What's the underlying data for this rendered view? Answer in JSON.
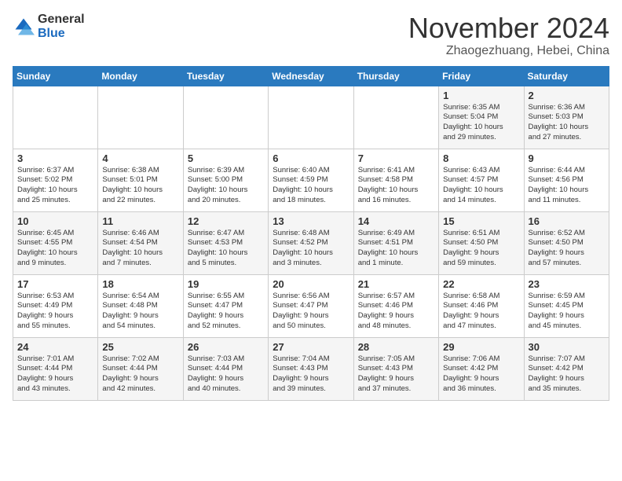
{
  "logo": {
    "general": "General",
    "blue": "Blue"
  },
  "title": "November 2024",
  "location": "Zhaogezhuang, Hebei, China",
  "days_of_week": [
    "Sunday",
    "Monday",
    "Tuesday",
    "Wednesday",
    "Thursday",
    "Friday",
    "Saturday"
  ],
  "weeks": [
    [
      {
        "day": "",
        "info": ""
      },
      {
        "day": "",
        "info": ""
      },
      {
        "day": "",
        "info": ""
      },
      {
        "day": "",
        "info": ""
      },
      {
        "day": "",
        "info": ""
      },
      {
        "day": "1",
        "info": "Sunrise: 6:35 AM\nSunset: 5:04 PM\nDaylight: 10 hours\nand 29 minutes."
      },
      {
        "day": "2",
        "info": "Sunrise: 6:36 AM\nSunset: 5:03 PM\nDaylight: 10 hours\nand 27 minutes."
      }
    ],
    [
      {
        "day": "3",
        "info": "Sunrise: 6:37 AM\nSunset: 5:02 PM\nDaylight: 10 hours\nand 25 minutes."
      },
      {
        "day": "4",
        "info": "Sunrise: 6:38 AM\nSunset: 5:01 PM\nDaylight: 10 hours\nand 22 minutes."
      },
      {
        "day": "5",
        "info": "Sunrise: 6:39 AM\nSunset: 5:00 PM\nDaylight: 10 hours\nand 20 minutes."
      },
      {
        "day": "6",
        "info": "Sunrise: 6:40 AM\nSunset: 4:59 PM\nDaylight: 10 hours\nand 18 minutes."
      },
      {
        "day": "7",
        "info": "Sunrise: 6:41 AM\nSunset: 4:58 PM\nDaylight: 10 hours\nand 16 minutes."
      },
      {
        "day": "8",
        "info": "Sunrise: 6:43 AM\nSunset: 4:57 PM\nDaylight: 10 hours\nand 14 minutes."
      },
      {
        "day": "9",
        "info": "Sunrise: 6:44 AM\nSunset: 4:56 PM\nDaylight: 10 hours\nand 11 minutes."
      }
    ],
    [
      {
        "day": "10",
        "info": "Sunrise: 6:45 AM\nSunset: 4:55 PM\nDaylight: 10 hours\nand 9 minutes."
      },
      {
        "day": "11",
        "info": "Sunrise: 6:46 AM\nSunset: 4:54 PM\nDaylight: 10 hours\nand 7 minutes."
      },
      {
        "day": "12",
        "info": "Sunrise: 6:47 AM\nSunset: 4:53 PM\nDaylight: 10 hours\nand 5 minutes."
      },
      {
        "day": "13",
        "info": "Sunrise: 6:48 AM\nSunset: 4:52 PM\nDaylight: 10 hours\nand 3 minutes."
      },
      {
        "day": "14",
        "info": "Sunrise: 6:49 AM\nSunset: 4:51 PM\nDaylight: 10 hours\nand 1 minute."
      },
      {
        "day": "15",
        "info": "Sunrise: 6:51 AM\nSunset: 4:50 PM\nDaylight: 9 hours\nand 59 minutes."
      },
      {
        "day": "16",
        "info": "Sunrise: 6:52 AM\nSunset: 4:50 PM\nDaylight: 9 hours\nand 57 minutes."
      }
    ],
    [
      {
        "day": "17",
        "info": "Sunrise: 6:53 AM\nSunset: 4:49 PM\nDaylight: 9 hours\nand 55 minutes."
      },
      {
        "day": "18",
        "info": "Sunrise: 6:54 AM\nSunset: 4:48 PM\nDaylight: 9 hours\nand 54 minutes."
      },
      {
        "day": "19",
        "info": "Sunrise: 6:55 AM\nSunset: 4:47 PM\nDaylight: 9 hours\nand 52 minutes."
      },
      {
        "day": "20",
        "info": "Sunrise: 6:56 AM\nSunset: 4:47 PM\nDaylight: 9 hours\nand 50 minutes."
      },
      {
        "day": "21",
        "info": "Sunrise: 6:57 AM\nSunset: 4:46 PM\nDaylight: 9 hours\nand 48 minutes."
      },
      {
        "day": "22",
        "info": "Sunrise: 6:58 AM\nSunset: 4:46 PM\nDaylight: 9 hours\nand 47 minutes."
      },
      {
        "day": "23",
        "info": "Sunrise: 6:59 AM\nSunset: 4:45 PM\nDaylight: 9 hours\nand 45 minutes."
      }
    ],
    [
      {
        "day": "24",
        "info": "Sunrise: 7:01 AM\nSunset: 4:44 PM\nDaylight: 9 hours\nand 43 minutes."
      },
      {
        "day": "25",
        "info": "Sunrise: 7:02 AM\nSunset: 4:44 PM\nDaylight: 9 hours\nand 42 minutes."
      },
      {
        "day": "26",
        "info": "Sunrise: 7:03 AM\nSunset: 4:44 PM\nDaylight: 9 hours\nand 40 minutes."
      },
      {
        "day": "27",
        "info": "Sunrise: 7:04 AM\nSunset: 4:43 PM\nDaylight: 9 hours\nand 39 minutes."
      },
      {
        "day": "28",
        "info": "Sunrise: 7:05 AM\nSunset: 4:43 PM\nDaylight: 9 hours\nand 37 minutes."
      },
      {
        "day": "29",
        "info": "Sunrise: 7:06 AM\nSunset: 4:42 PM\nDaylight: 9 hours\nand 36 minutes."
      },
      {
        "day": "30",
        "info": "Sunrise: 7:07 AM\nSunset: 4:42 PM\nDaylight: 9 hours\nand 35 minutes."
      }
    ]
  ]
}
